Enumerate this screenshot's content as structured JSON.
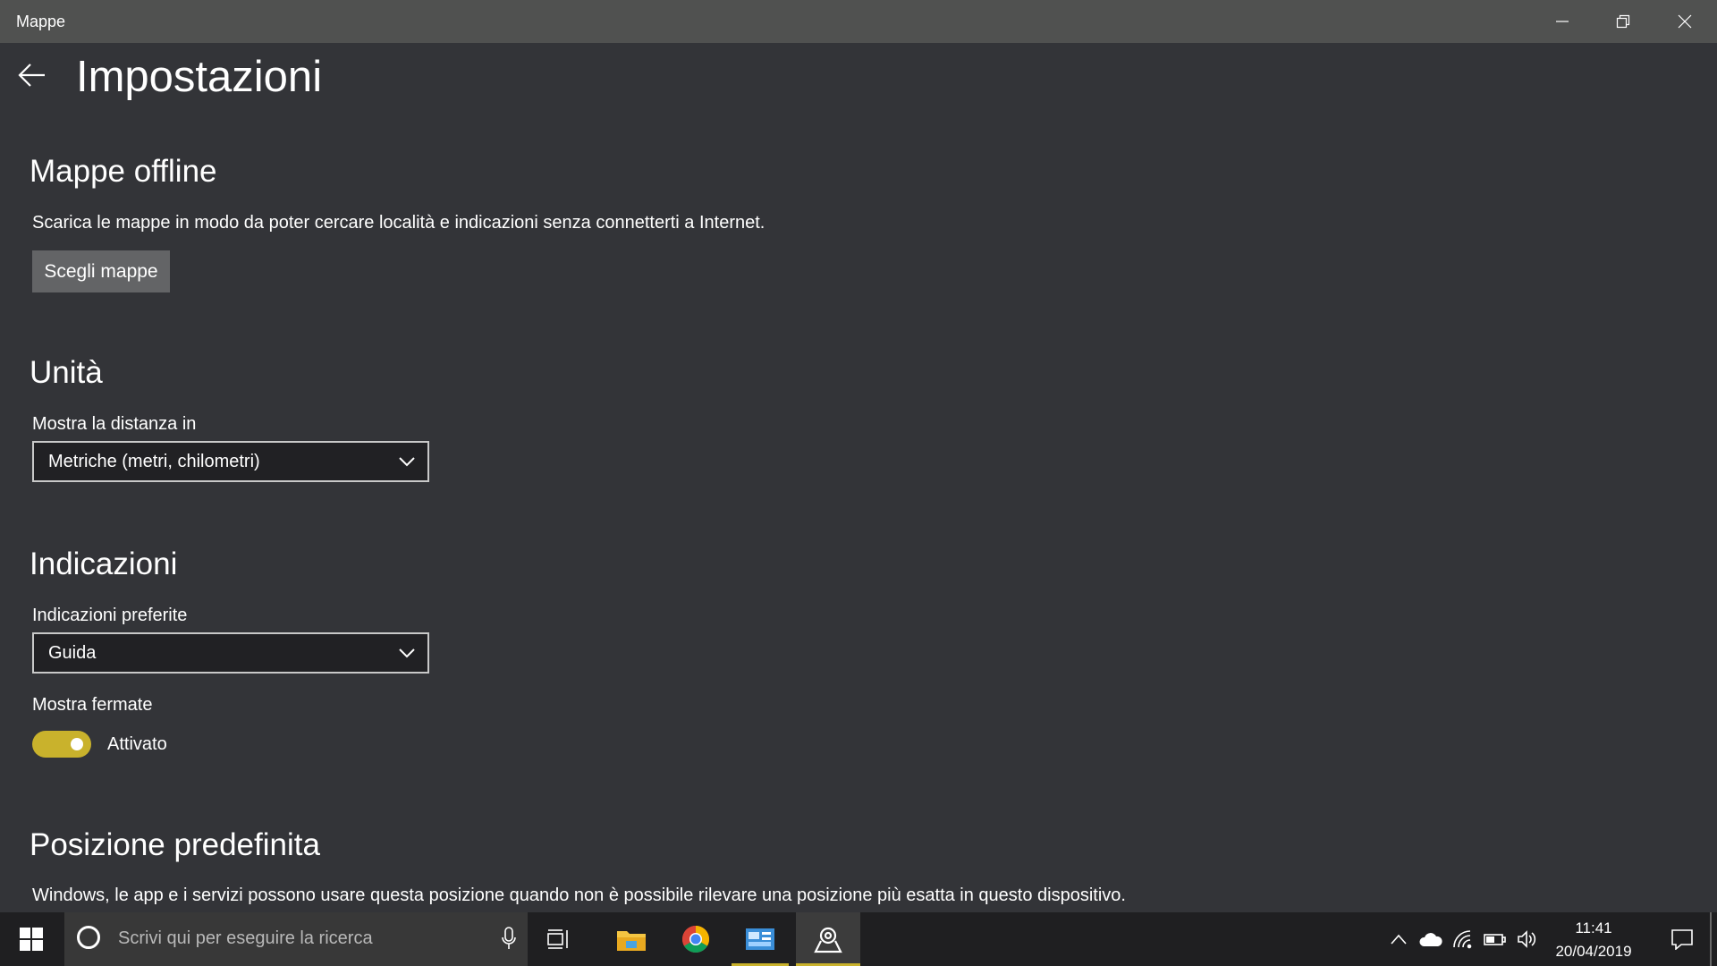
{
  "window": {
    "title": "Mappe"
  },
  "header": {
    "title": "Impostazioni"
  },
  "offline": {
    "heading": "Mappe offline",
    "description": "Scarica le mappe in modo da poter cercare località e indicazioni senza connetterti a Internet.",
    "button_label": "Scegli mappe"
  },
  "units": {
    "heading": "Unità",
    "label": "Mostra la distanza in",
    "selected": "Metriche (metri, chilometri)"
  },
  "directions": {
    "heading": "Indicazioni",
    "preferred_label": "Indicazioni preferite",
    "preferred_selected": "Guida",
    "stops_label": "Mostra fermate",
    "stops_toggle_state": "Attivato",
    "stops_toggle_on": true
  },
  "default_position": {
    "heading": "Posizione predefinita",
    "description": "Windows, le app e i servizi possono usare questa posizione quando non è possibile rilevare una posizione più esatta in questo dispositivo."
  },
  "taskbar": {
    "search_placeholder": "Scrivi qui per eseguire la ricerca",
    "time": "11:41",
    "date": "20/04/2019",
    "pinned_apps": [
      "task-view-icon",
      "file-explorer-icon",
      "chrome-icon",
      "control-panel-icon",
      "maps-icon"
    ]
  },
  "colors": {
    "accent": "#c9b22c",
    "background": "#333438",
    "titlebar": "#505150",
    "taskbar": "#1f1f21"
  }
}
